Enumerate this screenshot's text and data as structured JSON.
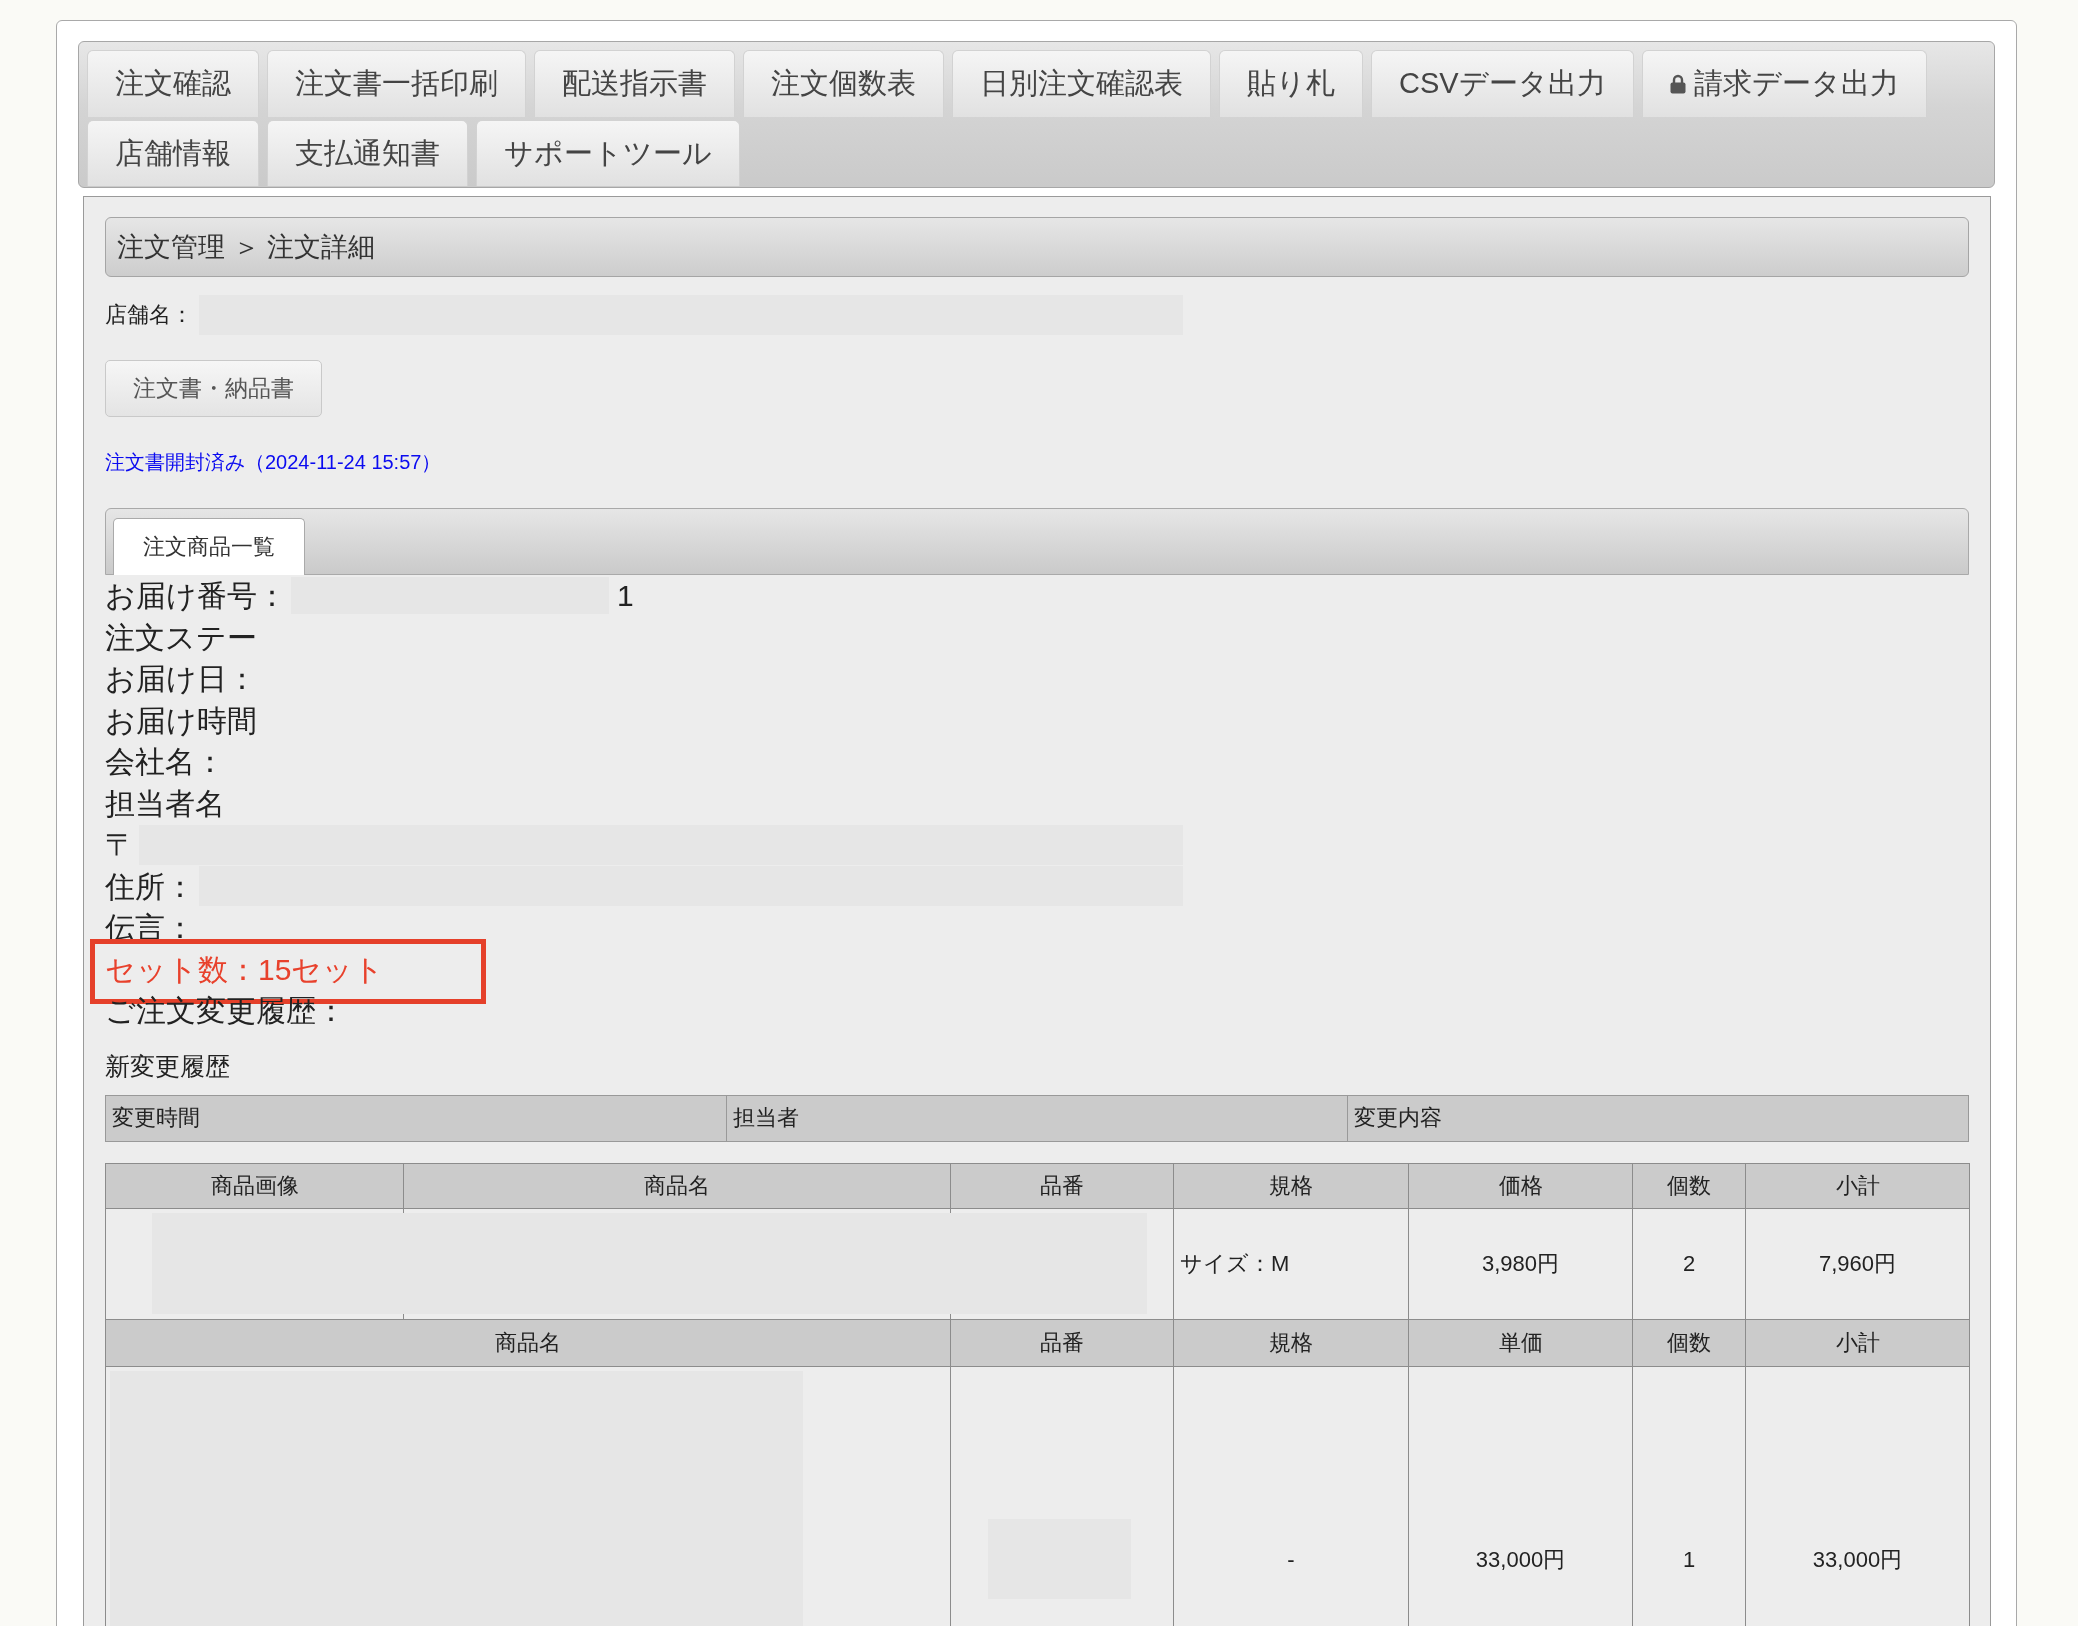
{
  "tab_rows": [
    {
      "tabs": [
        {
          "label": "注文確認",
          "locked": false
        },
        {
          "label": "注文書一括印刷",
          "locked": false
        },
        {
          "label": "配送指示書",
          "locked": false
        },
        {
          "label": "注文個数表",
          "locked": false
        },
        {
          "label": "日別注文確認表",
          "locked": false
        },
        {
          "label": "貼り札",
          "locked": false
        },
        {
          "label": "CSVデータ出力",
          "locked": false
        },
        {
          "label": "請求データ出力",
          "locked": true
        }
      ]
    },
    {
      "tabs": [
        {
          "label": "店舗情報",
          "locked": false
        },
        {
          "label": "支払通知書",
          "locked": false
        },
        {
          "label": "サポートツール",
          "locked": false
        }
      ]
    }
  ],
  "breadcrumb": "注文管理 ＞ 注文詳細",
  "store": {
    "label": "店舗名：",
    "redacted": true
  },
  "document_button": "注文書・納品書",
  "open_status": "注文書開封済み（2024-11-24 15:57）",
  "panel_tabs": [
    {
      "label": "注文商品一覧",
      "selected": true
    }
  ],
  "details": [
    {
      "label": "お届け番号：",
      "redacted": true,
      "value": "1",
      "highlighted": false
    },
    {
      "label": "注文ステー",
      "redacted": false,
      "highlighted": false
    },
    {
      "label": "お届け日：",
      "redacted": false,
      "highlighted": false
    },
    {
      "label": "お届け時間",
      "redacted": false,
      "highlighted": false
    },
    {
      "label": "会社名：",
      "redacted": false,
      "highlighted": false
    },
    {
      "label": "担当者名",
      "redacted": false,
      "highlighted": false
    },
    {
      "label": "〒",
      "redacted": true,
      "highlighted": false
    },
    {
      "label": "住所：",
      "redacted": true,
      "highlighted": false
    },
    {
      "label": "伝言：",
      "redacted": false,
      "highlighted": false
    },
    {
      "label": "セット数：15セット",
      "redacted": false,
      "highlighted": true
    },
    {
      "label": "ご注文変更履歴：",
      "redacted": false,
      "highlighted": false
    }
  ],
  "history": {
    "title": "新変更履歴",
    "columns": [
      "変更時間",
      "担当者",
      "変更内容"
    ]
  },
  "order_table": {
    "sections": [
      {
        "columns": [
          {
            "label": "商品画像",
            "wide": false
          },
          {
            "label": "商品名",
            "wide": false
          },
          {
            "label": "品番",
            "wide": false
          },
          {
            "label": "規格",
            "wide": false
          },
          {
            "label": "価格",
            "wide": false
          },
          {
            "label": "個数",
            "wide": false
          },
          {
            "label": "小計",
            "wide": false
          }
        ],
        "rows": [
          {
            "redacted": true,
            "cells": [
              "",
              "",
              "",
              "サイズ：M",
              "3,980円",
              "2",
              "7,960円"
            ]
          }
        ]
      },
      {
        "columns": [
          {
            "label": "商品名",
            "wide": true
          },
          {
            "label": "品番",
            "wide": false
          },
          {
            "label": "規格",
            "wide": false
          },
          {
            "label": "単価",
            "wide": false
          },
          {
            "label": "個数",
            "wide": false
          },
          {
            "label": "小計",
            "wide": false
          }
        ],
        "rows": [
          {
            "redacted": true,
            "cells": [
              "",
              "",
              "-",
              "33,000円",
              "1",
              "33,000円"
            ]
          }
        ]
      }
    ]
  }
}
